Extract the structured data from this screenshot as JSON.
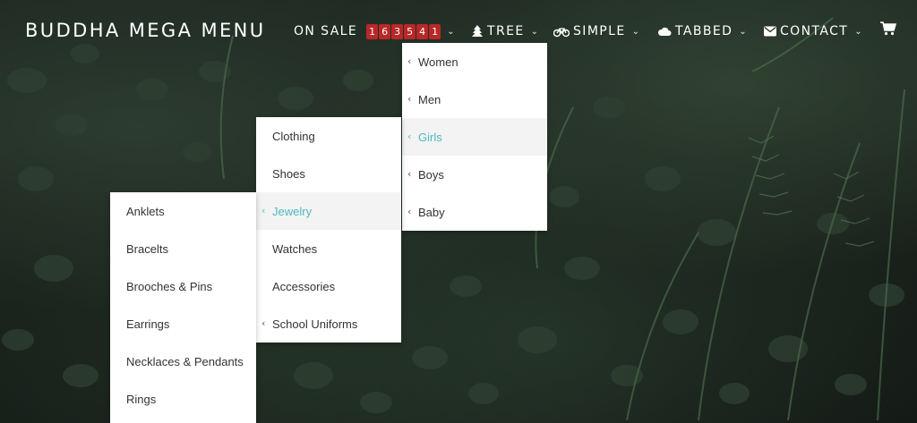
{
  "brand": "BUDDHA MEGA MENU",
  "nav": {
    "on_sale": "ON SALE",
    "counter_digits": [
      "1",
      "6",
      "3",
      "5",
      "4",
      "1"
    ],
    "tree": "TREE",
    "simple": "SIMPLE",
    "tabbed": "TABBED",
    "contact": "CONTACT"
  },
  "icons": {
    "tree": "tree-icon",
    "simple": "bicycle-icon",
    "tabbed": "cloud-icon",
    "contact": "envelope-icon",
    "cart": "cart-icon"
  },
  "colors": {
    "active_text": "#4fb9c0",
    "counter_bg": "#b82828",
    "active_bg": "#f3f3f3"
  },
  "menus": {
    "tree": [
      "Women",
      "Men",
      "Girls",
      "Boys",
      "Baby"
    ],
    "girls": [
      "Clothing",
      "Shoes",
      "Jewelry",
      "Watches",
      "Accessories",
      "School Uniforms"
    ],
    "jewelry": [
      "Anklets",
      "Bracelts",
      "Brooches & Pins",
      "Earrings",
      "Necklaces & Pendants",
      "Rings"
    ]
  }
}
